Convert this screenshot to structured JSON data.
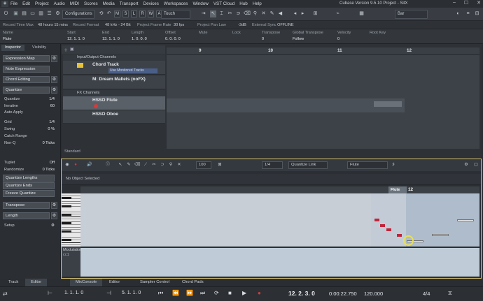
{
  "titlebar": {
    "menu": [
      "File",
      "Edit",
      "Project",
      "Audio",
      "MIDI",
      "Scores",
      "Media",
      "Transport",
      "Devices",
      "Workspaces",
      "Window",
      "VST Cloud",
      "Hub",
      "Help"
    ],
    "title": "Cubase Version 9.5.10 Project - SitX",
    "controls": [
      "–",
      "☐",
      "✕"
    ]
  },
  "toolbar": {
    "configurations": "Configurations",
    "mode_buttons": [
      "M",
      "S",
      "L",
      "R",
      "W",
      "A"
    ],
    "touch": "Touch",
    "bar": "Bar"
  },
  "infobar": {
    "items": [
      "Record Time Max",
      "48 hours 15 mins",
      "Record Format",
      "48 kHz - 24 Bit",
      "Project Frame Rate",
      "30 fps",
      "Project Pan Law",
      "-3dB",
      "External Sync",
      "OFFLINE"
    ]
  },
  "event_header": {
    "labels": [
      "Name",
      "Start",
      "End",
      "Length",
      "Offset",
      "Mute",
      "Lock",
      "Transpose",
      "Global Transpose",
      "Velocity",
      "Root Key"
    ],
    "values": [
      "Flute",
      "12. 1. 1. 0",
      "13. 1. 1. 0",
      "1. 0. 0. 0",
      "0. 0. 0. 0",
      "",
      "",
      "0",
      "Follow",
      "0",
      ""
    ]
  },
  "inspector": {
    "tabs": [
      "Inspector",
      "Visibility"
    ],
    "sections": [
      "Expression Map",
      "Note Expression",
      "Chord Editing",
      "Quantize"
    ],
    "quantize_rows": [
      {
        "label": "Quantize",
        "value": "1/4"
      },
      {
        "label": "Iterative",
        "value": "60"
      },
      {
        "label": "Auto Apply",
        "value": ""
      },
      {
        "label": "Grid",
        "value": "1/4"
      },
      {
        "label": "Swing",
        "value": "0 %"
      },
      {
        "label": "Catch Range",
        "value": ""
      },
      {
        "label": "Non-Q",
        "value": "0 Ticks"
      },
      {
        "label": "Tuplet",
        "value": "Off"
      },
      {
        "label": "Randomize",
        "value": "0 Ticks"
      }
    ],
    "buttons": [
      "Quantize Lengths",
      "Quantize Ends",
      "Freeze Quantize"
    ],
    "sections2": [
      "Transpose",
      "Length"
    ],
    "setup": "Setup"
  },
  "tracks": {
    "folder1": "Input/Output Channels",
    "chord": "Chord Track",
    "chord_btn": "Use Monitored Tracks",
    "midi": "M: Dream Mallets (noFX)",
    "folder2": "FX Channels",
    "flute": "HSSO Flute",
    "oboe": "HSSO Oboe",
    "footer": "Standard"
  },
  "ruler": {
    "bars": [
      "9",
      "10",
      "11",
      "12"
    ]
  },
  "editor": {
    "no_object": "No Object Selected",
    "zoom": "100",
    "quantize_val": "1/4",
    "quantize_link": "Quantize Link",
    "track": "Flute",
    "part_label": "Flute",
    "bar12": "12",
    "lane_label": "Modulation",
    "lane_sub": "cc1"
  },
  "bottom_tabs": [
    "Track",
    "Editor",
    "MixConsole",
    "Editor",
    "Sampler Control",
    "Chord Pads"
  ],
  "transport": {
    "left": "1. 1. 1. 0",
    "right": "5. 1. 1. 0",
    "position": "12. 2. 3. 0",
    "time": "0:00:22.750",
    "tempo": "120.000",
    "signature": "4/4"
  },
  "colors": {
    "accent": "#d9c271",
    "record": "#d63a3a",
    "chord_track": "#e5c23a",
    "note_red": "#c0243a",
    "playhead": "#e8e05a"
  }
}
